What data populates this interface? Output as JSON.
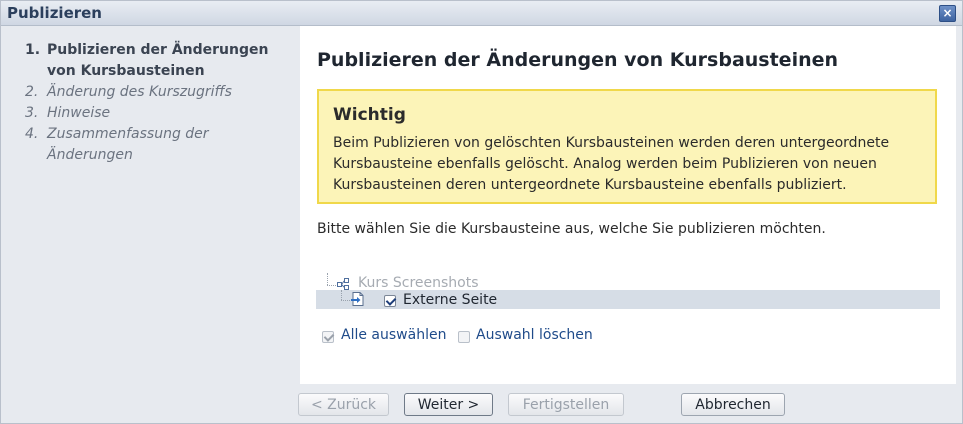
{
  "window": {
    "title": "Publizieren",
    "close_symbol": "×"
  },
  "steps": [
    {
      "num": "1.",
      "label": "Publizieren der Änderungen von Kursbausteinen",
      "active": true
    },
    {
      "num": "2.",
      "label": "Änderung des Kurszugriffs",
      "active": false
    },
    {
      "num": "3.",
      "label": "Hinweise",
      "active": false
    },
    {
      "num": "4.",
      "label": "Zusammenfassung der Änderungen",
      "active": false
    }
  ],
  "main": {
    "heading": "Publizieren der Änderungen von Kursbausteinen",
    "warning": {
      "title": "Wichtig",
      "text": "Beim Publizieren von gelöschten Kursbausteinen werden deren untergeordnete Kursbausteine ebenfalls gelöscht. Analog werden beim Publizieren von neuen Kursbausteinen deren untergeordnete Kursbausteine ebenfalls publiziert."
    },
    "instruction": "Bitte wählen Sie die Kursbausteine aus, welche Sie publizieren möchten.",
    "tree": {
      "root_label": "Kurs Screenshots",
      "root_icon": "course-structure-icon",
      "items": [
        {
          "label": "Externe Seite",
          "icon": "external-page-icon",
          "checked": true
        }
      ]
    },
    "select_all_label": "Alle auswählen",
    "clear_selection_label": "Auswahl löschen"
  },
  "footer": {
    "back_label": "< Zurück",
    "next_label": "Weiter >",
    "finish_label": "Fertigstellen",
    "cancel_label": "Abbrechen"
  },
  "colors": {
    "warning_bg": "#fcf4b8",
    "warning_border": "#f0d84a",
    "selected_row": "#d6dde6",
    "link": "#1f4b8a"
  }
}
